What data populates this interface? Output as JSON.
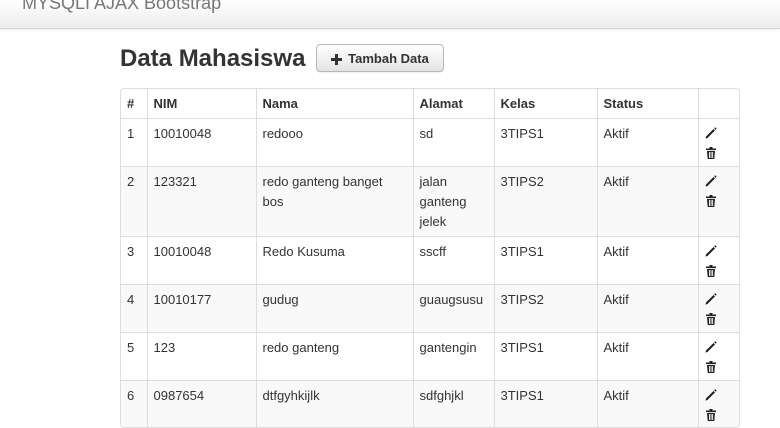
{
  "app": {
    "brand": "MYSQLI AJAX Bootstrap"
  },
  "page": {
    "title": "Data Mahasiswa",
    "add_button_label": "Tambah Data"
  },
  "table": {
    "headers": [
      "#",
      "NIM",
      "Nama",
      "Alamat",
      "Kelas",
      "Status",
      ""
    ],
    "rows": [
      {
        "no": "1",
        "nim": "10010048",
        "nama": "redooo",
        "alamat": "sd",
        "kelas": "3TIPS1",
        "status": "Aktif"
      },
      {
        "no": "2",
        "nim": "123321",
        "nama": "redo ganteng banget bos",
        "alamat": "jalan ganteng jelek",
        "kelas": "3TIPS2",
        "status": "Aktif"
      },
      {
        "no": "3",
        "nim": "10010048",
        "nama": "Redo Kusuma",
        "alamat": "sscff",
        "kelas": "3TIPS1",
        "status": "Aktif"
      },
      {
        "no": "4",
        "nim": "10010177",
        "nama": "gudug",
        "alamat": "guaugsusu",
        "kelas": "3TIPS2",
        "status": "Aktif"
      },
      {
        "no": "5",
        "nim": "123",
        "nama": "redo ganteng",
        "alamat": "gantengin",
        "kelas": "3TIPS1",
        "status": "Aktif"
      },
      {
        "no": "6",
        "nim": "0987654",
        "nama": "dtfgyhkijlk",
        "alamat": "sdfghjkl",
        "kelas": "3TIPS1",
        "status": "Aktif"
      }
    ]
  },
  "icons": {
    "add": "plus-icon",
    "edit": "pencil-icon",
    "delete": "trash-icon"
  }
}
